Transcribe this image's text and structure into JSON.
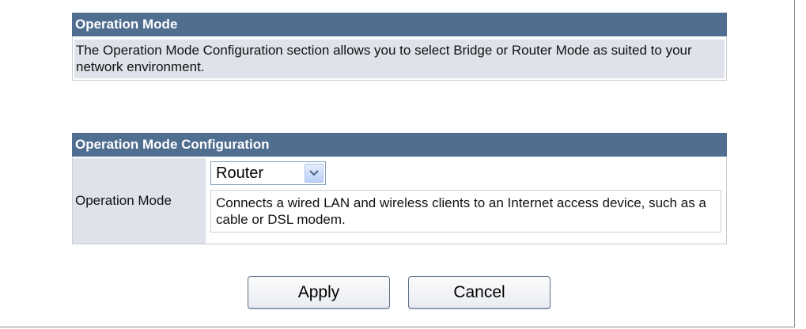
{
  "operation_mode_section": {
    "title": "Operation Mode",
    "description": "The Operation Mode Configuration section allows you to select Bridge or Router Mode as suited to your network environment."
  },
  "configuration_section": {
    "title": "Operation Mode Configuration",
    "field_label": "Operation Mode",
    "select_value": "Router",
    "mode_description": "Connects a wired LAN and wireless clients to an Internet access device, such as a cable or DSL modem."
  },
  "buttons": {
    "apply_label": "Apply",
    "cancel_label": "Cancel"
  },
  "colors": {
    "header_bg": "#4f6e90",
    "label_bg": "#dfe2ea",
    "select_arrow_icon": "chevron-down-icon"
  }
}
